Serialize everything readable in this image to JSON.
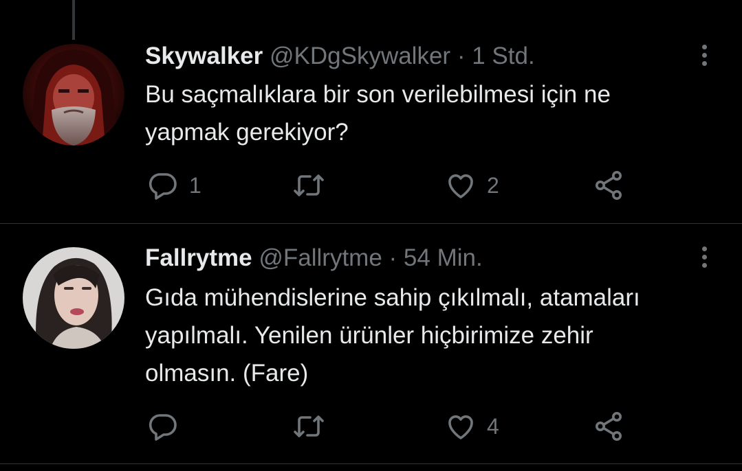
{
  "tweets": [
    {
      "display_name": "Skywalker",
      "handle": "@KDgSkywalker",
      "separator": "·",
      "time": "1 Std.",
      "text_lines": [
        "Bu saçmalıklara bir son verilebilmesi için ne",
        "yapmak gerekiyor?"
      ],
      "reply_count": "1",
      "retweet_count": "",
      "like_count": "2",
      "avatar": "hooded-bearded-man-avatar"
    },
    {
      "display_name": "Fallrytme",
      "handle": "@Fallrytme",
      "separator": "·",
      "time": "54 Min.",
      "text_lines": [
        "Gıda mühendislerine sahip çıkılmalı, atamaları",
        "yapılmalı. Yenilen ürünler hiçbirimize zehir",
        "olmasın. (Fare)"
      ],
      "reply_count": "",
      "retweet_count": "",
      "like_count": "4",
      "avatar": "woman-portrait-avatar"
    }
  ],
  "icons": {
    "reply": "reply-icon",
    "retweet": "retweet-icon",
    "like": "heart-icon",
    "share": "share-icon",
    "more": "more-options-icon"
  },
  "colors": {
    "background": "#000000",
    "text": "#e7e9ea",
    "secondary": "#71767b",
    "divider": "#2f3336"
  }
}
